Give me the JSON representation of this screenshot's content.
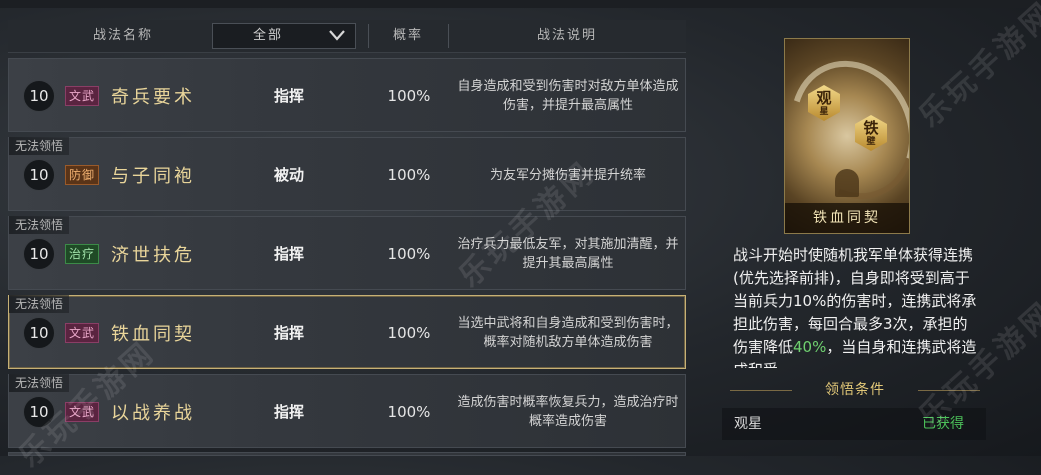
{
  "header": {
    "col_name": "战法名称",
    "filter_value": "全部",
    "col_rate": "概率",
    "col_desc": "战法说明"
  },
  "rows": [
    {
      "badge": "",
      "level": "10",
      "tag": "文武",
      "name": "奇兵要术",
      "type": "指挥",
      "rate": "100%",
      "desc": "自身造成和受到伤害时对敌方单体造成伤害，并提升最高属性"
    },
    {
      "badge": "无法领悟",
      "level": "10",
      "tag": "防御",
      "name": "与子同袍",
      "type": "被动",
      "rate": "100%",
      "desc": "为友军分摊伤害并提升统率"
    },
    {
      "badge": "无法领悟",
      "level": "10",
      "tag": "治疗",
      "name": "济世扶危",
      "type": "指挥",
      "rate": "100%",
      "desc": "治疗兵力最低友军，对其施加清醒，并提升其最高属性"
    },
    {
      "badge": "无法领悟",
      "level": "10",
      "tag": "文武",
      "name": "铁血同契",
      "type": "指挥",
      "rate": "100%",
      "desc": "当选中武将和自身造成和受到伤害时，概率对随机敌方单体造成伤害"
    },
    {
      "badge": "无法领悟",
      "level": "10",
      "tag": "文武",
      "name": "以战养战",
      "type": "指挥",
      "rate": "100%",
      "desc": "造成伤害时概率恢复兵力，造成治疗时概率造成伤害"
    }
  ],
  "card": {
    "hex1_main": "观",
    "hex1_sub": "星",
    "hex2_main": "铁",
    "hex2_sub": "壁",
    "name": "铁血同契"
  },
  "detail": {
    "text_a": "战斗开始时使随机我军单体获得连携(优先选择前排)，自身即将受到高于当前兵力10%的伤害时，连携武将承担此伤害，每回合最多3次，承担的伤害降低",
    "text_hl": "40%",
    "text_b": "，当自身和连携武将造成和受"
  },
  "condition": {
    "title": "领悟条件",
    "name": "观星",
    "status": "已获得"
  },
  "watermark": "乐玩手游网",
  "colors": {
    "accent_gold": "#e9d59a",
    "status_green": "#4cc25a",
    "selected_border": "#c7b176"
  }
}
